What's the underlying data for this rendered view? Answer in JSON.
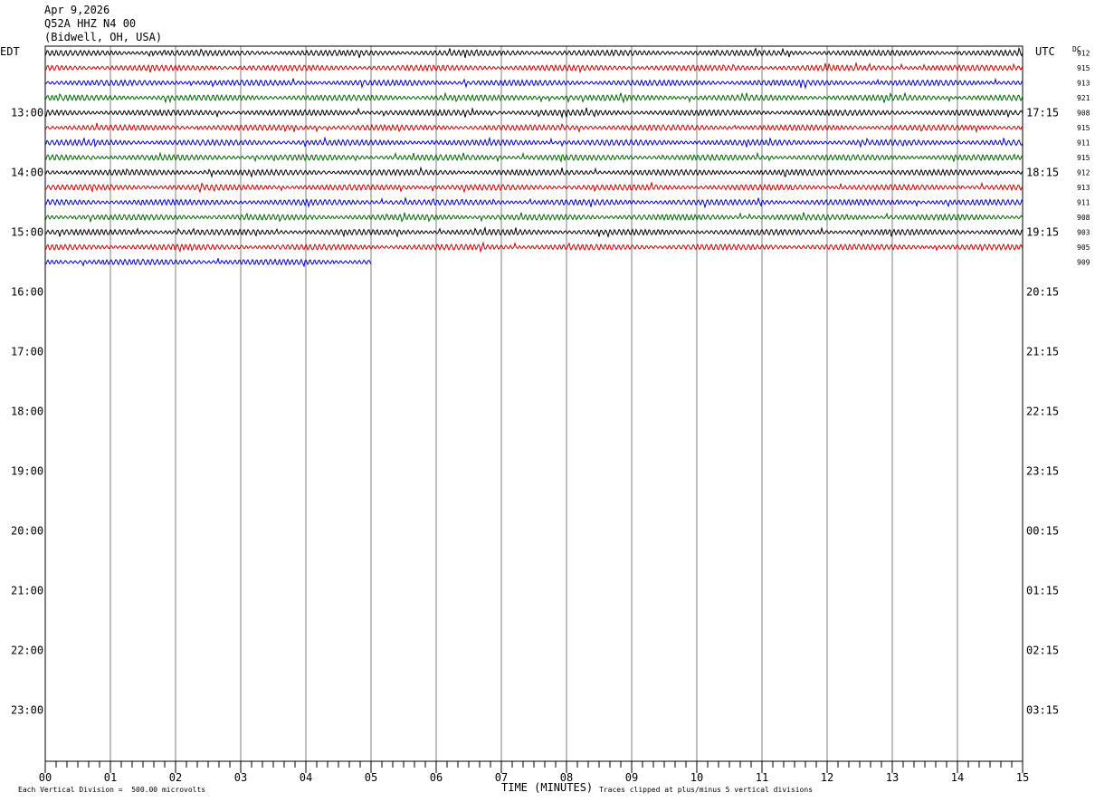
{
  "header": {
    "date": "Apr 9,2026",
    "station": "Q52A HHZ N4 00",
    "location": "(Bidwell, OH, USA)"
  },
  "left_timezone": "EDT",
  "right_timezone": "UTC",
  "dc_header": "DC",
  "footer": {
    "vertical_division": "Each Vertical Division =  500.00 microvolts",
    "xlabel": "TIME (MINUTES)",
    "clip_note": "Traces clipped at plus/minus 5 vertical divisions"
  },
  "colors": {
    "trace_cycle": [
      "#000000",
      "#cc0000",
      "#0000cc",
      "#006600"
    ],
    "gridline": "#808080",
    "frame": "#000000"
  },
  "chart_data": {
    "type": "line",
    "title": "Q52A HHZ N4 00",
    "xlabel": "TIME (MINUTES)",
    "xlim": [
      0,
      15
    ],
    "x_ticks": [
      "00",
      "01",
      "02",
      "03",
      "04",
      "05",
      "06",
      "07",
      "08",
      "09",
      "10",
      "11",
      "12",
      "13",
      "14",
      "15"
    ],
    "rows_per_hour": 4,
    "first_row_time": "12:00",
    "left_hour_labels": [
      "13:00",
      "14:00",
      "15:00",
      "16:00",
      "17:00",
      "18:00",
      "19:00",
      "20:00",
      "21:00",
      "22:00",
      "23:00"
    ],
    "right_hour_labels": [
      "17:15",
      "18:15",
      "19:15",
      "20:15",
      "21:15",
      "22:15",
      "23:15",
      "00:15",
      "01:15",
      "02:15",
      "03:15"
    ],
    "traces": [
      {
        "row": 0,
        "dc": "912",
        "x_end": 15
      },
      {
        "row": 1,
        "dc": "915",
        "x_end": 15
      },
      {
        "row": 2,
        "dc": "913",
        "x_end": 15
      },
      {
        "row": 3,
        "dc": "921",
        "x_end": 15
      },
      {
        "row": 4,
        "dc": "908",
        "x_end": 15
      },
      {
        "row": 5,
        "dc": "915",
        "x_end": 15
      },
      {
        "row": 6,
        "dc": "911",
        "x_end": 15
      },
      {
        "row": 7,
        "dc": "915",
        "x_end": 15
      },
      {
        "row": 8,
        "dc": "912",
        "x_end": 15
      },
      {
        "row": 9,
        "dc": "913",
        "x_end": 15
      },
      {
        "row": 10,
        "dc": "911",
        "x_end": 15
      },
      {
        "row": 11,
        "dc": "908",
        "x_end": 15
      },
      {
        "row": 12,
        "dc": "903",
        "x_end": 15
      },
      {
        "row": 13,
        "dc": "905",
        "x_end": 15
      },
      {
        "row": 14,
        "dc": "909",
        "x_end": 5
      }
    ]
  }
}
